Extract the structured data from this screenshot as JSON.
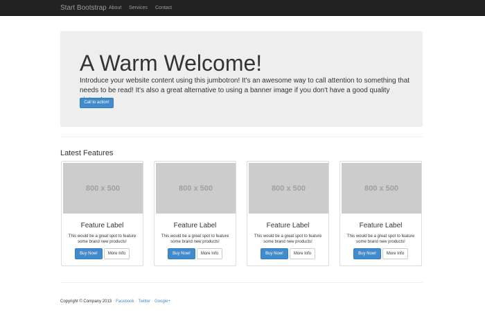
{
  "navbar": {
    "brand": "Start Bootstrap",
    "links": [
      "About",
      "Services",
      "Contact"
    ]
  },
  "jumbotron": {
    "title": "A Warm Welcome!",
    "text": "Introduce your website content using this jumbotron! It's an awesome way to call attention to something that needs to be read! It's also a great alternative to using a banner image if you don't have a good quality picture!",
    "button_label": "Call to action!"
  },
  "features": {
    "title": "Latest Features",
    "cards": [
      {
        "image_text": "800 x 500",
        "label": "Feature Label",
        "text": "This would be a great spot to feature some brand new products!",
        "buy_label": "Buy Now!",
        "more_label": "More Info"
      },
      {
        "image_text": "800 x 500",
        "label": "Feature Label",
        "text": "This would be a great spot to feature some brand new products!",
        "buy_label": "Buy Now!",
        "more_label": "More Info"
      },
      {
        "image_text": "800 x 500",
        "label": "Feature Label",
        "text": "This would be a great spot to feature some brand new products!",
        "buy_label": "Buy Now!",
        "more_label": "More Info"
      },
      {
        "image_text": "800 x 500",
        "label": "Feature Label",
        "text": "This would be a great spot to feature some brand new products!",
        "buy_label": "Buy Now!",
        "more_label": "More Info"
      }
    ]
  },
  "footer": {
    "copyright": "Copyright © Company 2013",
    "links": [
      "Facebook",
      "Twitter",
      "Google+"
    ]
  },
  "colors": {
    "navbar_bg": "#222222",
    "primary": "#428bca",
    "jumbotron_bg": "#eeeeee",
    "placeholder_bg": "#cccccc"
  }
}
